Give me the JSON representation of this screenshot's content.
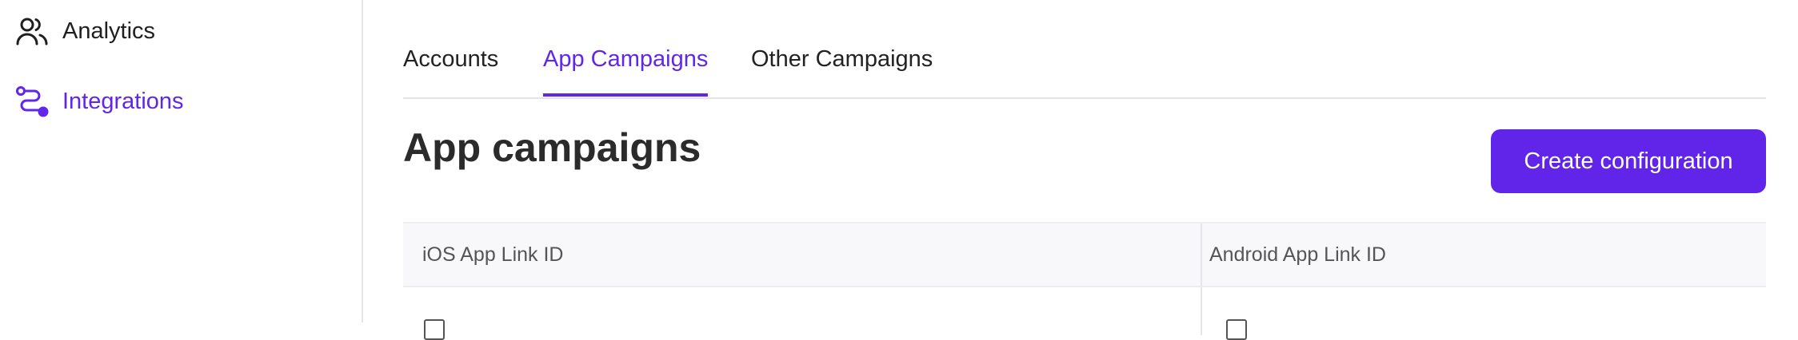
{
  "sidebar": {
    "items": [
      {
        "label": "Analytics",
        "icon": "users-icon",
        "active": false
      },
      {
        "label": "Integrations",
        "icon": "route-icon",
        "active": true
      }
    ]
  },
  "tabs": [
    {
      "label": "Accounts",
      "active": false
    },
    {
      "label": "App Campaigns",
      "active": true
    },
    {
      "label": "Other Campaigns",
      "active": false
    }
  ],
  "page": {
    "title": "App campaigns",
    "create_label": "Create configuration"
  },
  "table": {
    "columns": [
      "iOS App Link ID",
      "Android App Link ID"
    ]
  },
  "colors": {
    "accent": "#6127e8"
  }
}
